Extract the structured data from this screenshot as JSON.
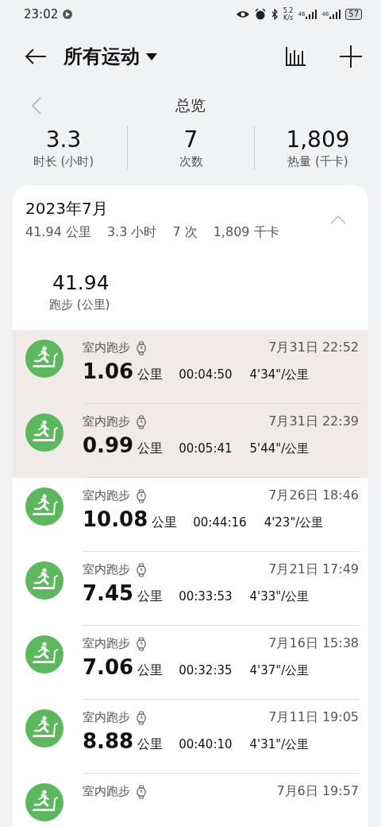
{
  "status_bar": {
    "time": "23:02",
    "speed_value": "5.2",
    "speed_unit": "K/s",
    "network_labels": [
      "46",
      "46"
    ],
    "battery": "57"
  },
  "header": {
    "title": "所有运动"
  },
  "overview": {
    "title": "总览",
    "stats": [
      {
        "value": "3.3",
        "label": "时长 (小时)"
      },
      {
        "value": "7",
        "label": "次数"
      },
      {
        "value": "1,809",
        "label": "热量 (千卡)"
      }
    ]
  },
  "month": {
    "title": "2023年7月",
    "summary": [
      "41.94 公里",
      "3.3 小时",
      "7 次",
      "1,809 千卡"
    ],
    "expanded": true,
    "total_value": "41.94",
    "total_label": "跑步 (公里)"
  },
  "records": [
    {
      "type": "室内跑步",
      "date": "7月31日 22:52",
      "distance": "1.06",
      "unit": "公里",
      "duration": "00:04:50",
      "pace": "4'34\"/公里",
      "highlighted": true
    },
    {
      "type": "室内跑步",
      "date": "7月31日 22:39",
      "distance": "0.99",
      "unit": "公里",
      "duration": "00:05:41",
      "pace": "5'44\"/公里",
      "highlighted": true
    },
    {
      "type": "室内跑步",
      "date": "7月26日 18:46",
      "distance": "10.08",
      "unit": "公里",
      "duration": "00:44:16",
      "pace": "4'23\"/公里",
      "highlighted": false
    },
    {
      "type": "室内跑步",
      "date": "7月21日 17:49",
      "distance": "7.45",
      "unit": "公里",
      "duration": "00:33:53",
      "pace": "4'33\"/公里",
      "highlighted": false
    },
    {
      "type": "室内跑步",
      "date": "7月16日 15:38",
      "distance": "7.06",
      "unit": "公里",
      "duration": "00:32:35",
      "pace": "4'37\"/公里",
      "highlighted": false
    },
    {
      "type": "室内跑步",
      "date": "7月11日 19:05",
      "distance": "8.88",
      "unit": "公里",
      "duration": "00:40:10",
      "pace": "4'31\"/公里",
      "highlighted": false
    },
    {
      "type": "室内跑步",
      "date": "7月6日 19:57",
      "highlighted": false
    }
  ]
}
